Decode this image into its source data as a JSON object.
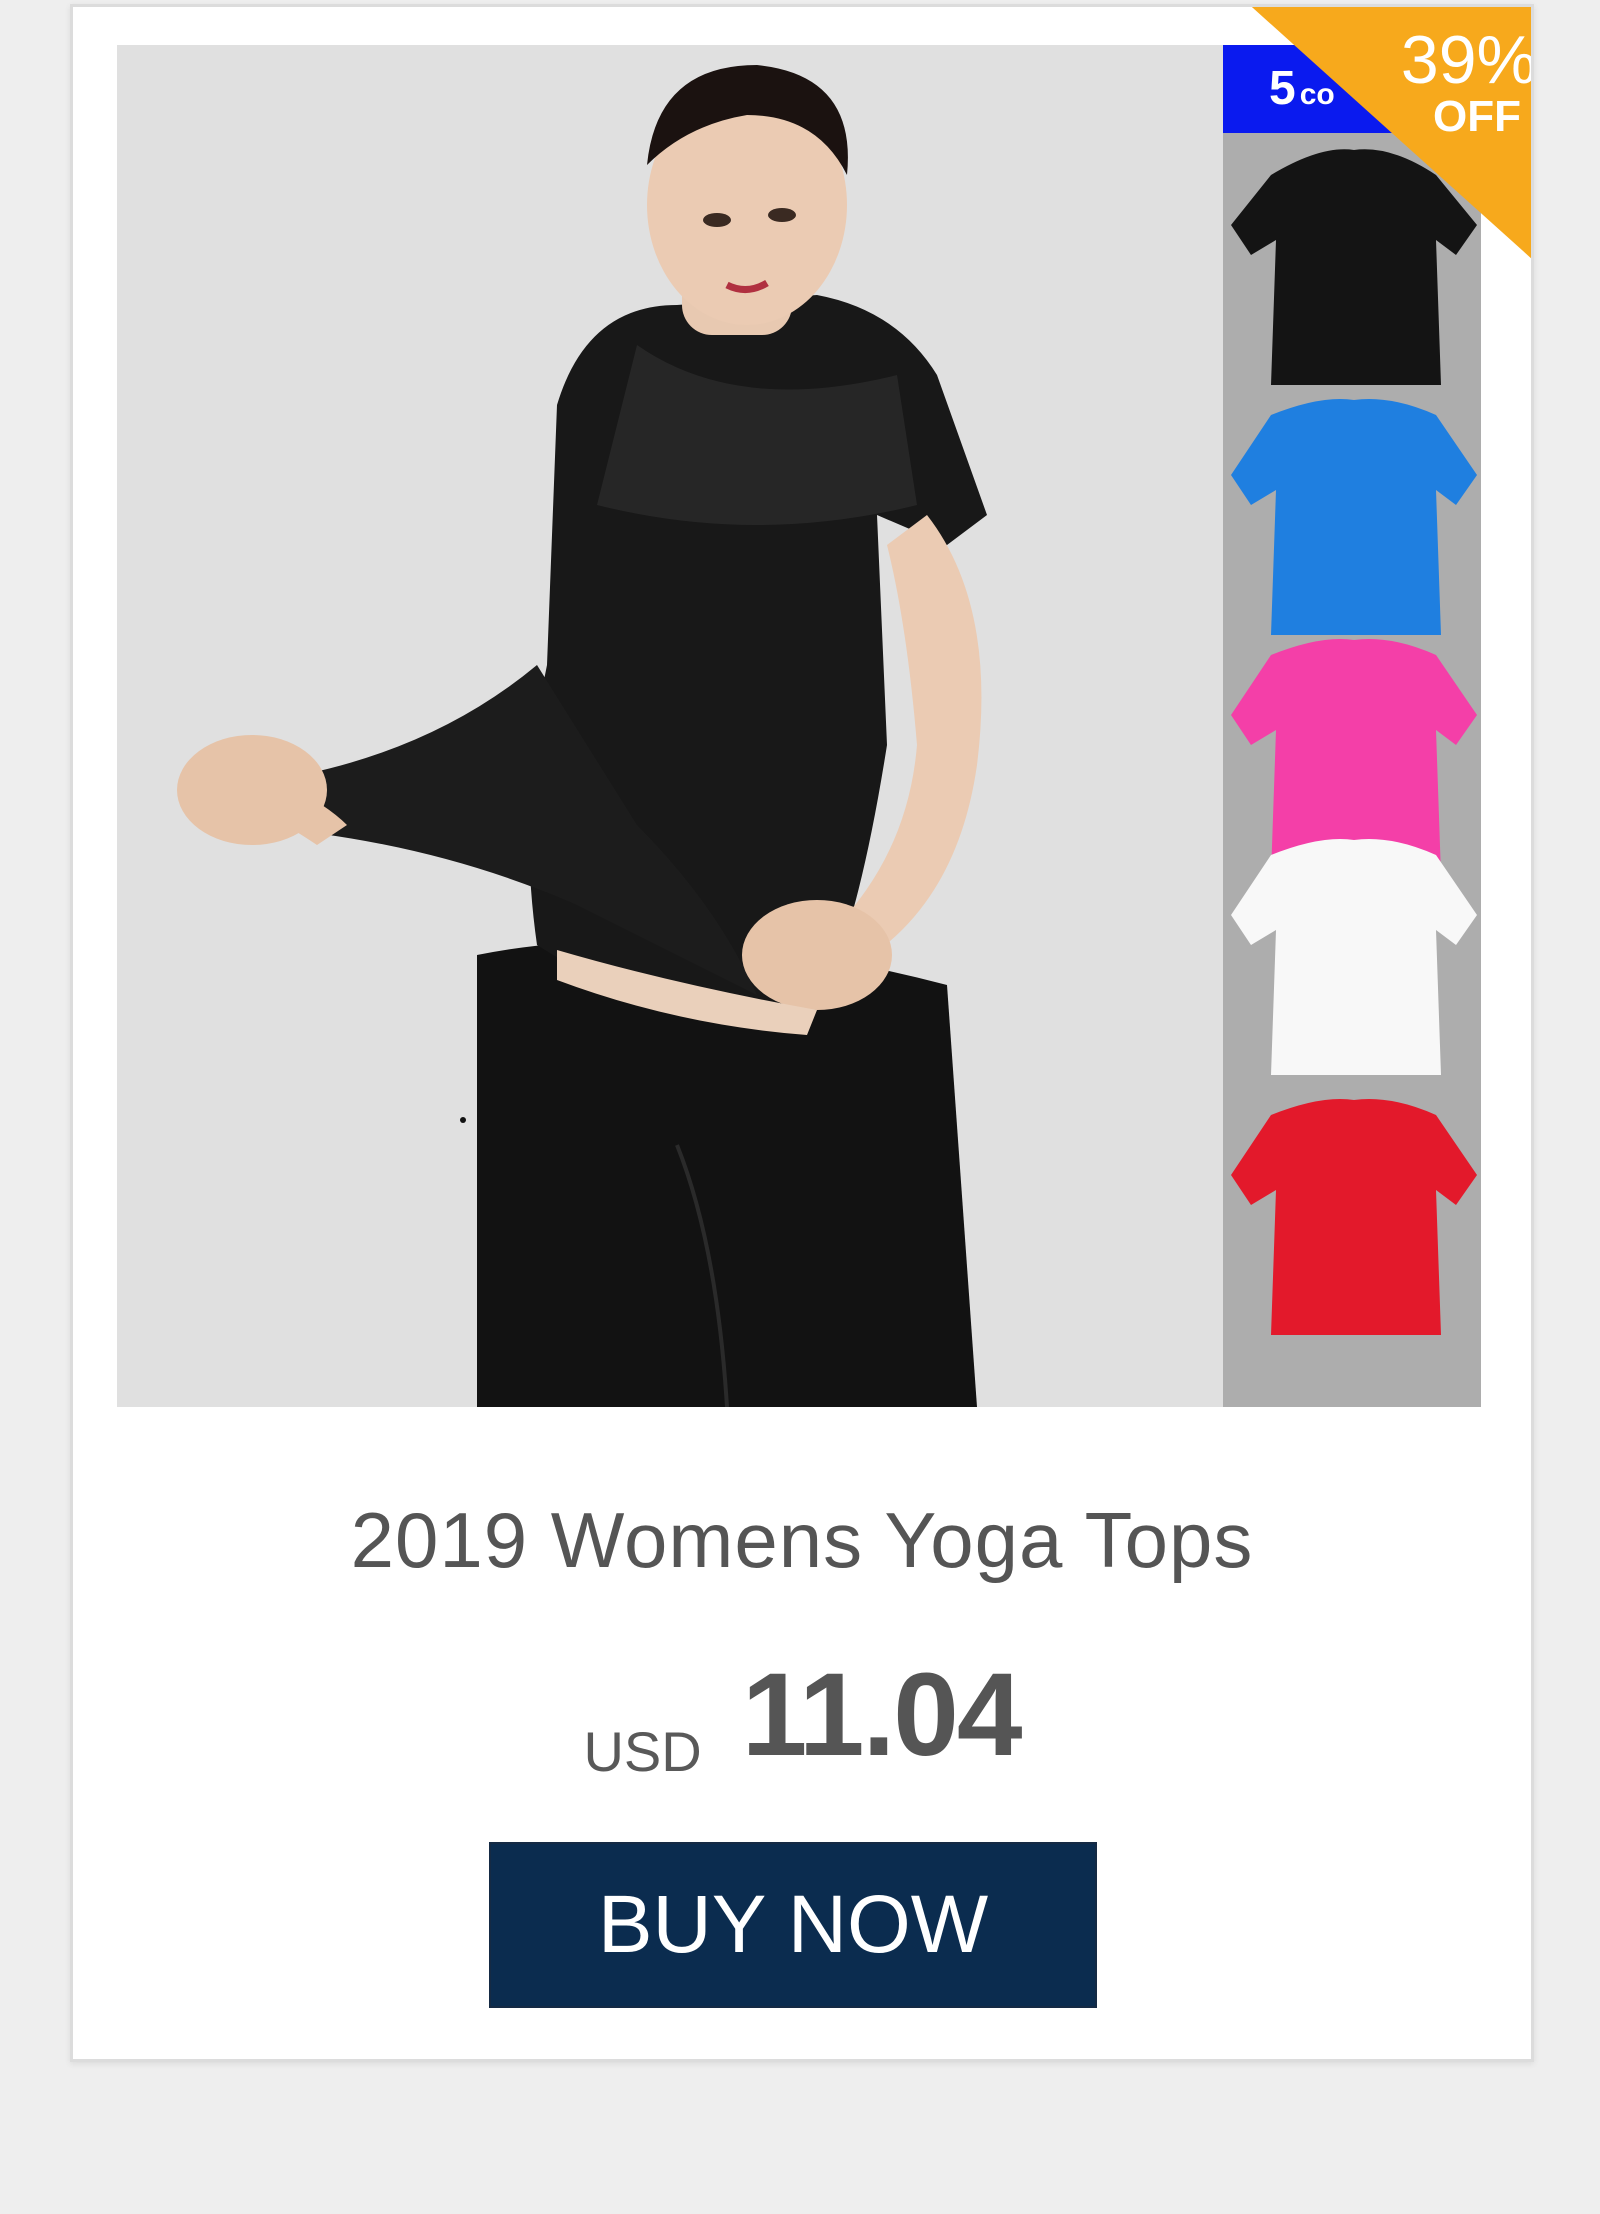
{
  "product": {
    "title": "2019 Womens Yoga Tops",
    "currency": "USD",
    "price": "11.04",
    "buy_label": "BUY NOW"
  },
  "badges": {
    "colors_count": "5",
    "colors_rest": "co",
    "discount_percent": "39%",
    "discount_suffix": "OFF",
    "discount_color": "#f7a91c",
    "colors_tab_color": "#0a1aef"
  },
  "swatches": [
    {
      "name": "black",
      "color": "#141414"
    },
    {
      "name": "blue",
      "color": "#1f7fe0"
    },
    {
      "name": "pink",
      "color": "#f43fa8"
    },
    {
      "name": "white",
      "color": "#f8f8f8"
    },
    {
      "name": "red",
      "color": "#e3192b"
    }
  ],
  "theme": {
    "button_color": "#0b2c4f",
    "text_color": "#555555"
  }
}
